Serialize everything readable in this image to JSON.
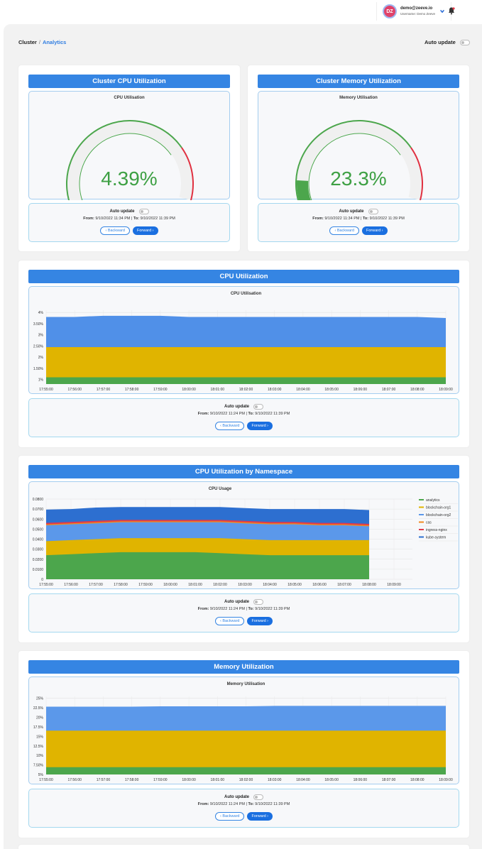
{
  "header": {
    "avatar_initials": "DZ",
    "email": "demo@zeeve.io",
    "username": "Username: Demo Zeeve"
  },
  "breadcrumb": {
    "root": "Cluster",
    "separator": "/",
    "current": "Analytics"
  },
  "top_auto_update": "Auto update",
  "colors": {
    "accent": "#3585e3",
    "green": "#4ca64c",
    "yellow": "#e0b400",
    "blue": "#5090e8",
    "red": "#e04050"
  },
  "controls_common": {
    "auto_update": "Auto update",
    "from": "From:",
    "to": "To:",
    "backward": "‹ Backward",
    "forward": "Forward ›"
  },
  "cpu_gauge": {
    "title": "Cluster CPU Utilization",
    "subtitle": "CPU Utilisation",
    "value_text": "4.39%",
    "from_value": "9/10/2022 11:34 PM",
    "to_value": "9/10/2022 11:39 PM"
  },
  "mem_gauge": {
    "title": "Cluster Memory Utilization",
    "subtitle": "Memory Utilisation",
    "value_text": "23.3%",
    "from_value": "9/10/2022 11:34 PM",
    "to_value": "9/10/2022 11:39 PM"
  },
  "cpu_chart": {
    "title": "CPU Utilization",
    "from_value": "9/10/2022 11:24 PM",
    "to_value": "9/10/2022 11:39 PM"
  },
  "ns_chart": {
    "title": "CPU Utilization by Namespace",
    "from_value": "9/10/2022 11:24 PM",
    "to_value": "9/10/2022 11:39 PM"
  },
  "mem_chart": {
    "title": "Memory Utilization",
    "from_value": "9/10/2022 11:24 PM",
    "to_value": "9/10/2022 11:39 PM"
  },
  "chart_data": [
    {
      "type": "gauge",
      "title": "CPU Utilisation",
      "value": 4.39,
      "range": [
        0,
        100
      ],
      "unit": "%"
    },
    {
      "type": "gauge",
      "title": "Memory Utilisation",
      "value": 23.3,
      "range": [
        0,
        100
      ],
      "unit": "%"
    },
    {
      "type": "area",
      "title": "CPU Utilisation",
      "x": [
        "17:55:00",
        "17:56:00",
        "17:57:00",
        "17:58:00",
        "17:59:00",
        "18:00:00",
        "18:01:00",
        "18:02:00",
        "18:03:00",
        "18:04:00",
        "18:05:00",
        "18:06:00",
        "18:07:00",
        "18:08:00",
        "18:09:00"
      ],
      "yticks": [
        "1%",
        "1.50%",
        "2%",
        "2.50%",
        "3%",
        "3.50%",
        "4%"
      ],
      "ylim": [
        0.8,
        4.1
      ],
      "series": [
        {
          "color": "#4ca64c",
          "values": [
            1.1,
            1.1,
            1.1,
            1.1,
            1.1,
            1.1,
            1.1,
            1.1,
            1.1,
            1.1,
            1.1,
            1.1,
            1.1,
            1.1,
            1.1
          ]
        },
        {
          "color": "#e0b400",
          "values": [
            2.45,
            2.45,
            2.45,
            2.45,
            2.45,
            2.45,
            2.45,
            2.45,
            2.45,
            2.45,
            2.45,
            2.45,
            2.45,
            2.45,
            2.45
          ]
        },
        {
          "color": "#5090e8",
          "values": [
            3.8,
            3.8,
            3.85,
            3.85,
            3.85,
            3.8,
            3.8,
            3.8,
            3.8,
            3.8,
            3.8,
            3.8,
            3.8,
            3.8,
            3.75
          ]
        }
      ],
      "grid": true
    },
    {
      "type": "area",
      "title": "CPU Usage",
      "x": [
        "17:55:00",
        "17:56:00",
        "17:57:00",
        "17:58:00",
        "17:59:00",
        "18:00:00",
        "18:01:00",
        "18:02:00",
        "18:03:00",
        "18:04:00",
        "18:05:00",
        "18:06:00",
        "18:07:00",
        "18:08:00",
        "18:09:00"
      ],
      "yticks": [
        "0",
        "0.0100",
        "0.0200",
        "0.0300",
        "0.0400",
        "0.0500",
        "0.0600",
        "0.0700",
        "0.0800"
      ],
      "ylim": [
        0,
        0.08
      ],
      "legend_position": "right",
      "series": [
        {
          "name": "analytics",
          "color": "#4ca64c",
          "values": [
            0.024,
            0.025,
            0.026,
            0.027,
            0.027,
            0.027,
            0.027,
            0.026,
            0.025,
            0.024,
            0.024,
            0.024,
            0.024,
            0.024,
            null
          ]
        },
        {
          "name": "blockchain-org1",
          "color": "#e0b400",
          "values": [
            0.038,
            0.039,
            0.04,
            0.041,
            0.041,
            0.041,
            0.041,
            0.041,
            0.04,
            0.039,
            0.039,
            0.039,
            0.039,
            0.039,
            null
          ]
        },
        {
          "name": "blockchain-org2",
          "color": "#5b98ea",
          "values": [
            0.054,
            0.055,
            0.056,
            0.057,
            0.057,
            0.057,
            0.057,
            0.057,
            0.056,
            0.055,
            0.055,
            0.054,
            0.054,
            0.053,
            null
          ]
        },
        {
          "name": "cas",
          "color": "#f08a20",
          "values": [
            0.0545,
            0.0555,
            0.0565,
            0.0575,
            0.0575,
            0.0575,
            0.0575,
            0.0575,
            0.0565,
            0.0555,
            0.0555,
            0.0545,
            0.0545,
            0.0535,
            null
          ]
        },
        {
          "name": "ingress-nginx",
          "color": "#e03a4a",
          "values": [
            0.0555,
            0.0565,
            0.0575,
            0.0585,
            0.0585,
            0.0585,
            0.0585,
            0.0585,
            0.0575,
            0.0565,
            0.0565,
            0.0555,
            0.0555,
            0.0545,
            null
          ]
        },
        {
          "name": "kube-system",
          "color": "#2d6fd0",
          "values": [
            0.0695,
            0.07,
            0.0715,
            0.072,
            0.072,
            0.072,
            0.072,
            0.072,
            0.071,
            0.07,
            0.07,
            0.07,
            0.07,
            0.069,
            null
          ]
        }
      ],
      "grid": true
    },
    {
      "type": "area",
      "title": "Memory Utilisation",
      "x": [
        "17:55:00",
        "17:56:00",
        "17:57:00",
        "17:58:00",
        "17:59:00",
        "18:00:00",
        "18:01:00",
        "18:02:00",
        "18:03:00",
        "18:04:00",
        "18:05:00",
        "18:06:00",
        "18:07:00",
        "18:08:00",
        "18:09:00"
      ],
      "yticks": [
        "5%",
        "7.50%",
        "10%",
        "12.5%",
        "15%",
        "17.5%",
        "20%",
        "22.5%",
        "25%"
      ],
      "ylim": [
        5,
        25.5
      ],
      "series": [
        {
          "color": "#4ca64c",
          "values": [
            6.9,
            6.9,
            6.9,
            6.9,
            6.9,
            6.9,
            6.9,
            6.9,
            6.9,
            6.9,
            6.9,
            6.9,
            6.9,
            6.9,
            6.9
          ]
        },
        {
          "color": "#e0b400",
          "values": [
            16.5,
            16.5,
            16.5,
            16.5,
            16.5,
            16.5,
            16.5,
            16.5,
            16.5,
            16.5,
            16.5,
            16.5,
            16.5,
            16.5,
            16.5
          ]
        },
        {
          "color": "#5b98ea",
          "values": [
            22.8,
            22.8,
            22.8,
            22.8,
            22.9,
            22.9,
            22.9,
            22.9,
            23.0,
            23.0,
            23.0,
            23.0,
            23.0,
            23.0,
            23.0
          ]
        }
      ],
      "grid": true
    }
  ]
}
